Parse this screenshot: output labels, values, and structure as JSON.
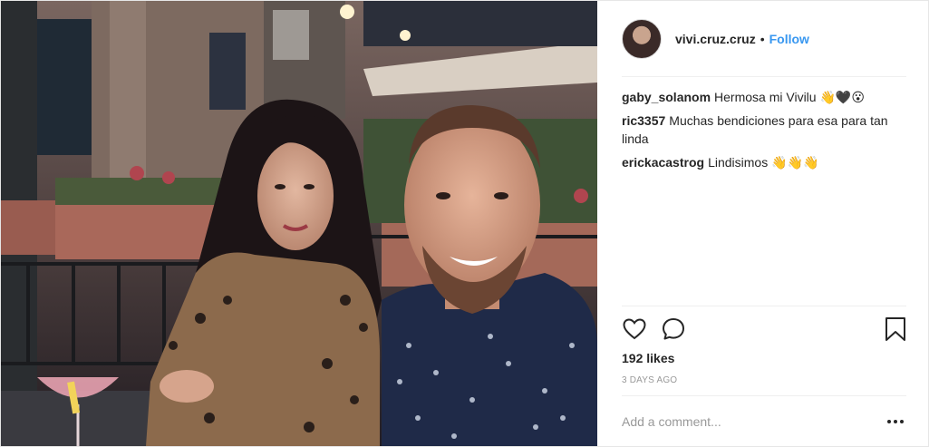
{
  "post": {
    "author": {
      "username": "vivi.cruz.cruz",
      "separator": "•",
      "follow_label": "Follow",
      "avatar_icon": "avatar-photo"
    },
    "comments": [
      {
        "user": "gaby_solanom",
        "text": "Hermosa mi Vivilu 👋🖤😮"
      },
      {
        "user": "ric3357",
        "text": "Muchas bendiciones para esa para tan linda"
      },
      {
        "user": "erickacastrog",
        "text": "Lindisimos 👋👋👋"
      }
    ],
    "actions": {
      "like_icon": "heart-icon",
      "comment_icon": "comment-bubble-icon",
      "save_icon": "bookmark-icon"
    },
    "likes_text": "192 likes",
    "time_text": "3 DAYS AGO",
    "add_comment_placeholder": "Add a comment...",
    "more_icon": "more-options-icon"
  },
  "colors": {
    "follow": "#3897f0",
    "text": "#262626",
    "muted": "#999999",
    "divider": "#efefef"
  }
}
